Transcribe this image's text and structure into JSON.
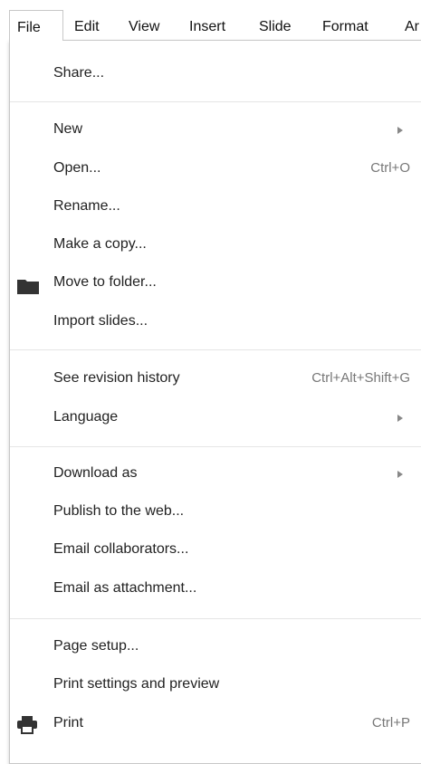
{
  "menubar": {
    "items": [
      {
        "label": "File"
      },
      {
        "label": "Edit"
      },
      {
        "label": "View"
      },
      {
        "label": "Insert"
      },
      {
        "label": "Slide"
      },
      {
        "label": "Format"
      },
      {
        "label": "Ar"
      }
    ]
  },
  "file_menu": {
    "share": {
      "label": "Share..."
    },
    "new": {
      "label": "New",
      "submenu_icon": "submenu-arrow-icon"
    },
    "open": {
      "label": "Open...",
      "shortcut": "Ctrl+O"
    },
    "rename": {
      "label": "Rename..."
    },
    "make_copy": {
      "label": "Make a copy..."
    },
    "move_to_folder": {
      "label": "Move to folder...",
      "icon": "folder-icon"
    },
    "import_slides": {
      "label": "Import slides..."
    },
    "revision_history": {
      "label": "See revision history",
      "shortcut": "Ctrl+Alt+Shift+G"
    },
    "language": {
      "label": "Language",
      "submenu_icon": "submenu-arrow-icon"
    },
    "download_as": {
      "label": "Download as",
      "submenu_icon": "submenu-arrow-icon"
    },
    "publish": {
      "label": "Publish to the web..."
    },
    "email_collaborators": {
      "label": "Email collaborators..."
    },
    "email_attachment": {
      "label": "Email as attachment..."
    },
    "page_setup": {
      "label": "Page setup..."
    },
    "print_settings": {
      "label": "Print settings and preview"
    },
    "print": {
      "label": "Print",
      "shortcut": "Ctrl+P",
      "icon": "printer-icon"
    }
  },
  "colors": {
    "text": "#222222",
    "shortcut_text": "#777777",
    "separator": "#e5e5e5",
    "menu_border": "#c8c8c8",
    "icon": "#333333"
  }
}
